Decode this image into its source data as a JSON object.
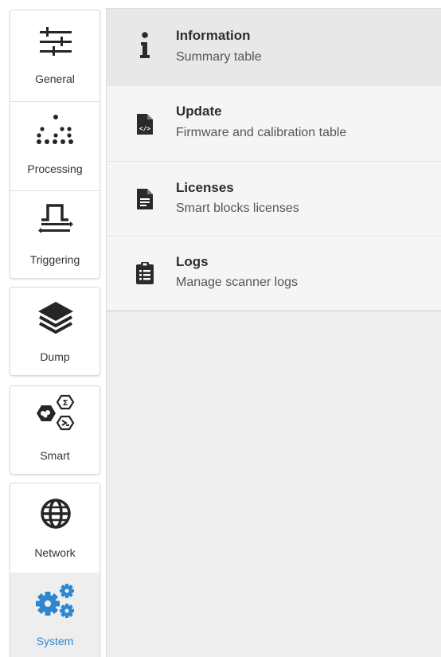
{
  "sidebar": {
    "general_label": "General",
    "processing_label": "Processing",
    "triggering_label": "Triggering",
    "dump_label": "Dump",
    "smart_label": "Smart",
    "network_label": "Network",
    "system_label": "System",
    "active_item": "System",
    "accent_color": "#2f86d0"
  },
  "menu": {
    "items": [
      {
        "title": "Information",
        "subtitle": "Summary table",
        "icon": "info-icon",
        "selected": true
      },
      {
        "title": "Update",
        "subtitle": "Firmware and calibration table",
        "icon": "code-file-icon"
      },
      {
        "title": "Licenses",
        "subtitle": "Smart blocks licenses",
        "icon": "document-icon"
      },
      {
        "title": "Logs",
        "subtitle": "Manage scanner logs",
        "icon": "clipboard-list-icon"
      }
    ]
  }
}
